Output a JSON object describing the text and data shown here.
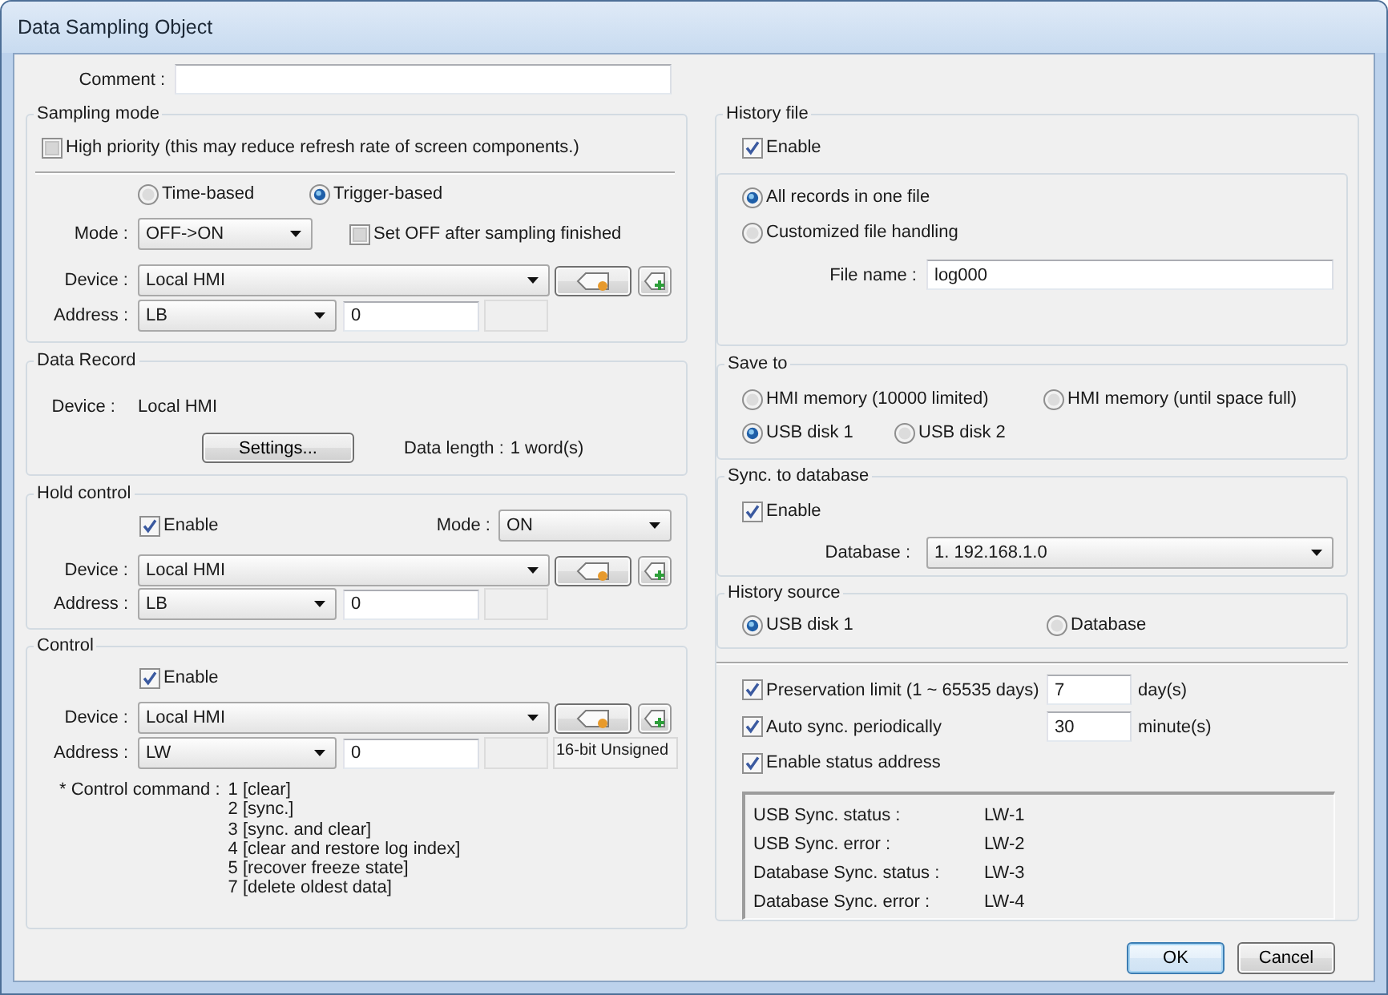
{
  "window": {
    "title": "Data Sampling Object"
  },
  "comment": {
    "label": "Comment :"
  },
  "sampling_mode": {
    "title": "Sampling mode",
    "high_priority": {
      "label": "High priority (this may reduce refresh rate of screen components.)",
      "checked": false
    },
    "trigger_types": [
      {
        "label": "Time-based",
        "selected": false
      },
      {
        "label": "Trigger-based",
        "selected": true
      }
    ],
    "mode": {
      "label": "Mode :",
      "value": "OFF->ON"
    },
    "set_off": {
      "label": "Set OFF after sampling finished",
      "checked": false
    },
    "device": {
      "label": "Device :",
      "value": "Local HMI"
    },
    "address": {
      "label": "Address :",
      "type": "LB",
      "value": "0"
    }
  },
  "data_record": {
    "title": "Data Record",
    "device": {
      "label": "Device :",
      "value": "Local HMI"
    },
    "settings_button": "Settings...",
    "data_length": {
      "label": "Data length :",
      "value": "1 word(s)"
    }
  },
  "hold_control": {
    "title": "Hold control",
    "enable": {
      "label": "Enable",
      "checked": true
    },
    "mode": {
      "label": "Mode :",
      "value": "ON"
    },
    "device": {
      "label": "Device :",
      "value": "Local HMI"
    },
    "address": {
      "label": "Address :",
      "type": "LB",
      "value": "0"
    }
  },
  "control": {
    "title": "Control",
    "enable": {
      "label": "Enable",
      "checked": true
    },
    "device": {
      "label": "Device :",
      "value": "Local HMI"
    },
    "address": {
      "label": "Address :",
      "type": "LW",
      "value": "0",
      "data_type": "16-bit Unsigned"
    },
    "command_label": "* Control command :",
    "commands": [
      "1 [clear]",
      "2 [sync.]",
      "3 [sync. and clear]",
      "4 [clear and restore log index]",
      "5 [recover freeze state]",
      "7 [delete oldest data]"
    ]
  },
  "history_file": {
    "title": "History file",
    "enable": {
      "label": "Enable",
      "checked": true
    },
    "file_modes": [
      {
        "label": "All records in one file",
        "selected": true
      },
      {
        "label": "Customized file handling",
        "selected": false
      }
    ],
    "file_name": {
      "label": "File name :",
      "value": "log000"
    }
  },
  "save_to": {
    "title": "Save to",
    "options": [
      {
        "label": "HMI memory (10000 limited)",
        "selected": false
      },
      {
        "label": "HMI memory (until space full)",
        "selected": false
      },
      {
        "label": "USB disk 1",
        "selected": true
      },
      {
        "label": "USB disk 2",
        "selected": false
      }
    ]
  },
  "sync_to_database": {
    "title": "Sync. to database",
    "enable": {
      "label": "Enable",
      "checked": true
    },
    "database": {
      "label": "Database :",
      "value": "1. 192.168.1.0"
    }
  },
  "history_source": {
    "title": "History source",
    "options": [
      {
        "label": "USB disk 1",
        "selected": true
      },
      {
        "label": "Database",
        "selected": false
      }
    ]
  },
  "options": [
    {
      "kind": "number",
      "label": "Preservation limit (1 ~ 65535 days)",
      "checked": true,
      "value": "7",
      "unit": "day(s)"
    },
    {
      "kind": "number",
      "label": "Auto sync. periodically",
      "checked": true,
      "value": "30",
      "unit": "minute(s)"
    },
    {
      "kind": "plain",
      "label": "Enable status address",
      "checked": true
    }
  ],
  "status_addresses": [
    {
      "label": "USB Sync. status :",
      "value": "LW-1"
    },
    {
      "label": "USB Sync. error :",
      "value": "LW-2"
    },
    {
      "label": "Database Sync. status :",
      "value": "LW-3"
    },
    {
      "label": "Database Sync. error :",
      "value": "LW-4"
    }
  ],
  "buttons": [
    {
      "label": "OK",
      "default": true
    },
    {
      "label": "Cancel",
      "default": false
    }
  ]
}
